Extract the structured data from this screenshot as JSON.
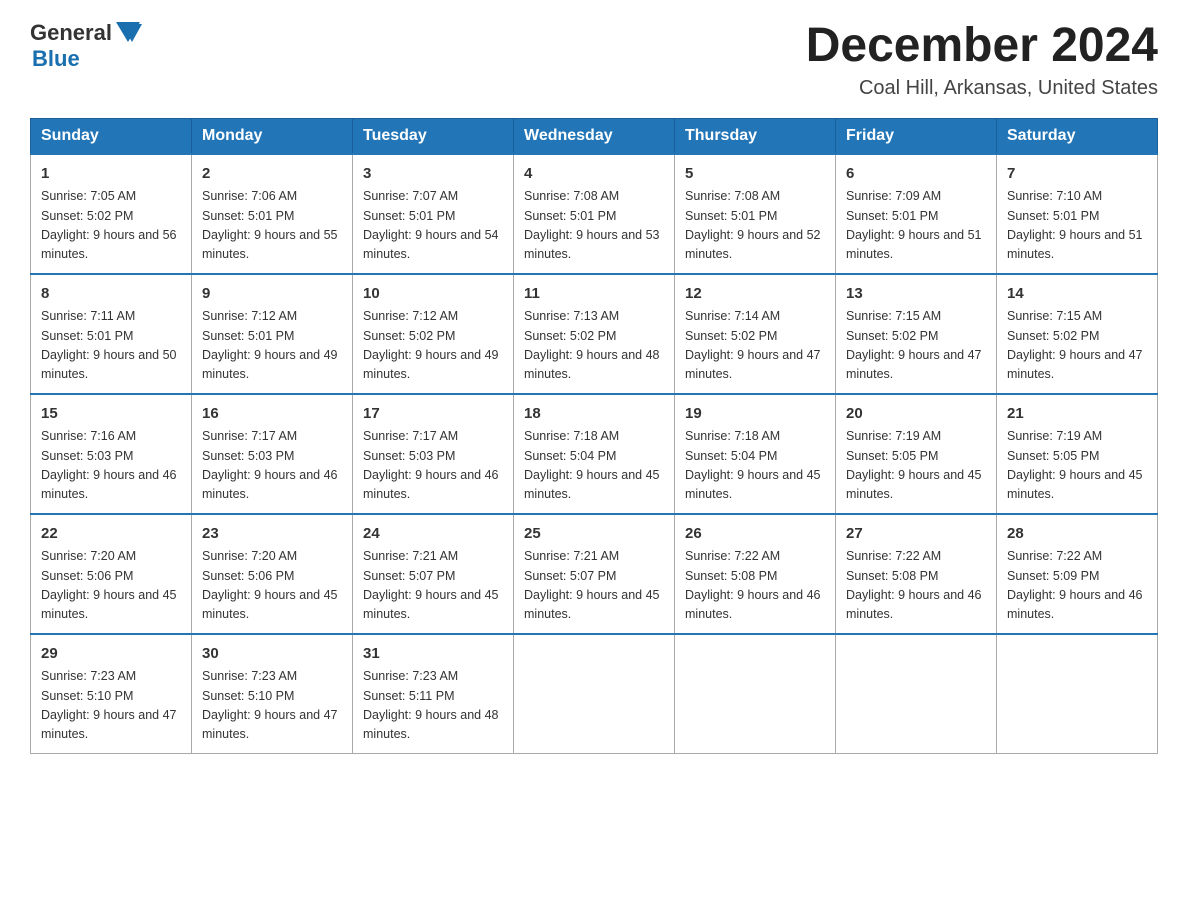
{
  "header": {
    "logo_general": "General",
    "logo_blue": "Blue",
    "month_title": "December 2024",
    "location": "Coal Hill, Arkansas, United States"
  },
  "days_of_week": [
    "Sunday",
    "Monday",
    "Tuesday",
    "Wednesday",
    "Thursday",
    "Friday",
    "Saturday"
  ],
  "weeks": [
    [
      {
        "day": "1",
        "sunrise": "7:05 AM",
        "sunset": "5:02 PM",
        "daylight": "9 hours and 56 minutes."
      },
      {
        "day": "2",
        "sunrise": "7:06 AM",
        "sunset": "5:01 PM",
        "daylight": "9 hours and 55 minutes."
      },
      {
        "day": "3",
        "sunrise": "7:07 AM",
        "sunset": "5:01 PM",
        "daylight": "9 hours and 54 minutes."
      },
      {
        "day": "4",
        "sunrise": "7:08 AM",
        "sunset": "5:01 PM",
        "daylight": "9 hours and 53 minutes."
      },
      {
        "day": "5",
        "sunrise": "7:08 AM",
        "sunset": "5:01 PM",
        "daylight": "9 hours and 52 minutes."
      },
      {
        "day": "6",
        "sunrise": "7:09 AM",
        "sunset": "5:01 PM",
        "daylight": "9 hours and 51 minutes."
      },
      {
        "day": "7",
        "sunrise": "7:10 AM",
        "sunset": "5:01 PM",
        "daylight": "9 hours and 51 minutes."
      }
    ],
    [
      {
        "day": "8",
        "sunrise": "7:11 AM",
        "sunset": "5:01 PM",
        "daylight": "9 hours and 50 minutes."
      },
      {
        "day": "9",
        "sunrise": "7:12 AM",
        "sunset": "5:01 PM",
        "daylight": "9 hours and 49 minutes."
      },
      {
        "day": "10",
        "sunrise": "7:12 AM",
        "sunset": "5:02 PM",
        "daylight": "9 hours and 49 minutes."
      },
      {
        "day": "11",
        "sunrise": "7:13 AM",
        "sunset": "5:02 PM",
        "daylight": "9 hours and 48 minutes."
      },
      {
        "day": "12",
        "sunrise": "7:14 AM",
        "sunset": "5:02 PM",
        "daylight": "9 hours and 47 minutes."
      },
      {
        "day": "13",
        "sunrise": "7:15 AM",
        "sunset": "5:02 PM",
        "daylight": "9 hours and 47 minutes."
      },
      {
        "day": "14",
        "sunrise": "7:15 AM",
        "sunset": "5:02 PM",
        "daylight": "9 hours and 47 minutes."
      }
    ],
    [
      {
        "day": "15",
        "sunrise": "7:16 AM",
        "sunset": "5:03 PM",
        "daylight": "9 hours and 46 minutes."
      },
      {
        "day": "16",
        "sunrise": "7:17 AM",
        "sunset": "5:03 PM",
        "daylight": "9 hours and 46 minutes."
      },
      {
        "day": "17",
        "sunrise": "7:17 AM",
        "sunset": "5:03 PM",
        "daylight": "9 hours and 46 minutes."
      },
      {
        "day": "18",
        "sunrise": "7:18 AM",
        "sunset": "5:04 PM",
        "daylight": "9 hours and 45 minutes."
      },
      {
        "day": "19",
        "sunrise": "7:18 AM",
        "sunset": "5:04 PM",
        "daylight": "9 hours and 45 minutes."
      },
      {
        "day": "20",
        "sunrise": "7:19 AM",
        "sunset": "5:05 PM",
        "daylight": "9 hours and 45 minutes."
      },
      {
        "day": "21",
        "sunrise": "7:19 AM",
        "sunset": "5:05 PM",
        "daylight": "9 hours and 45 minutes."
      }
    ],
    [
      {
        "day": "22",
        "sunrise": "7:20 AM",
        "sunset": "5:06 PM",
        "daylight": "9 hours and 45 minutes."
      },
      {
        "day": "23",
        "sunrise": "7:20 AM",
        "sunset": "5:06 PM",
        "daylight": "9 hours and 45 minutes."
      },
      {
        "day": "24",
        "sunrise": "7:21 AM",
        "sunset": "5:07 PM",
        "daylight": "9 hours and 45 minutes."
      },
      {
        "day": "25",
        "sunrise": "7:21 AM",
        "sunset": "5:07 PM",
        "daylight": "9 hours and 45 minutes."
      },
      {
        "day": "26",
        "sunrise": "7:22 AM",
        "sunset": "5:08 PM",
        "daylight": "9 hours and 46 minutes."
      },
      {
        "day": "27",
        "sunrise": "7:22 AM",
        "sunset": "5:08 PM",
        "daylight": "9 hours and 46 minutes."
      },
      {
        "day": "28",
        "sunrise": "7:22 AM",
        "sunset": "5:09 PM",
        "daylight": "9 hours and 46 minutes."
      }
    ],
    [
      {
        "day": "29",
        "sunrise": "7:23 AM",
        "sunset": "5:10 PM",
        "daylight": "9 hours and 47 minutes."
      },
      {
        "day": "30",
        "sunrise": "7:23 AM",
        "sunset": "5:10 PM",
        "daylight": "9 hours and 47 minutes."
      },
      {
        "day": "31",
        "sunrise": "7:23 AM",
        "sunset": "5:11 PM",
        "daylight": "9 hours and 48 minutes."
      },
      null,
      null,
      null,
      null
    ]
  ],
  "labels": {
    "sunrise_prefix": "Sunrise: ",
    "sunset_prefix": "Sunset: ",
    "daylight_prefix": "Daylight: "
  }
}
